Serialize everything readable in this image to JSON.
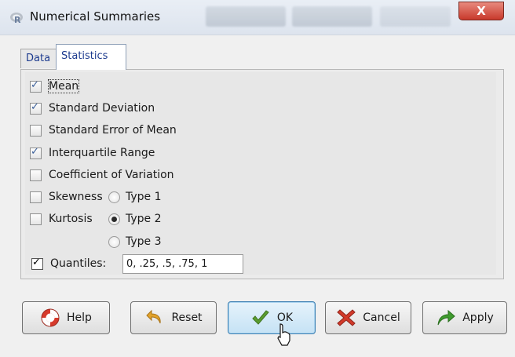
{
  "window": {
    "title": "Numerical Summaries",
    "close_symbol": "X"
  },
  "tabs": [
    {
      "label": "Data",
      "active": false
    },
    {
      "label": "Statistics",
      "active": true
    }
  ],
  "options": {
    "mean": {
      "label": "Mean",
      "checked": true
    },
    "sd": {
      "label": "Standard Deviation",
      "checked": true
    },
    "se_mean": {
      "label": "Standard Error of Mean",
      "checked": false
    },
    "iqr": {
      "label": "Interquartile Range",
      "checked": true
    },
    "cv": {
      "label": "Coefficient of Variation",
      "checked": false
    },
    "skewness": {
      "label": "Skewness",
      "checked": false
    },
    "kurtosis": {
      "label": "Kurtosis",
      "checked": false
    },
    "quantiles": {
      "label": "Quantiles:",
      "checked": true,
      "value": "0, .25, .5, .75, 1"
    }
  },
  "types": [
    {
      "label": "Type 1",
      "selected": false
    },
    {
      "label": "Type 2",
      "selected": true
    },
    {
      "label": "Type 3",
      "selected": false
    }
  ],
  "buttons": {
    "help": "Help",
    "reset": "Reset",
    "ok": "OK",
    "cancel": "Cancel",
    "apply": "Apply"
  },
  "colors": {
    "accent": "#3c7fb1",
    "ok_check": "#5a9e2f",
    "cancel_x": "#d23a2a",
    "apply_arrow": "#3f9b2e",
    "reset_arrow": "#e2a32b"
  }
}
